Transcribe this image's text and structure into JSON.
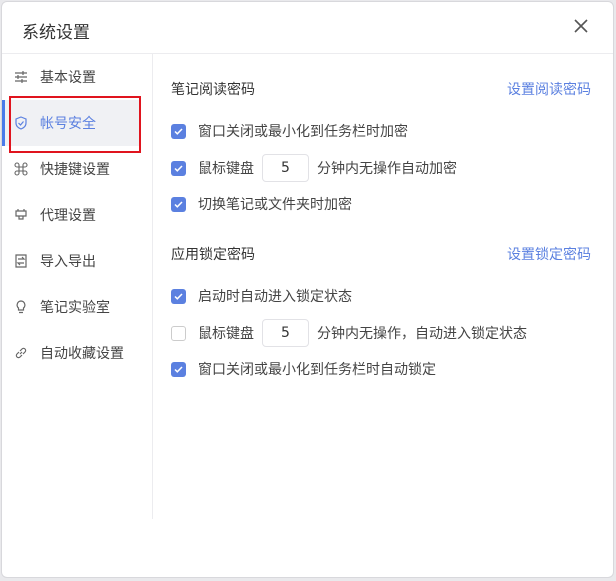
{
  "dialog": {
    "title": "系统设置",
    "close_icon": "close-icon"
  },
  "sidebar": {
    "items": [
      {
        "label": "基本设置",
        "icon": "sliders-icon"
      },
      {
        "label": "帐号安全",
        "icon": "shield-icon",
        "active": true
      },
      {
        "label": "快捷键设置",
        "icon": "command-icon"
      },
      {
        "label": "代理设置",
        "icon": "plug-icon"
      },
      {
        "label": "导入导出",
        "icon": "import-export-icon"
      },
      {
        "label": "笔记实验室",
        "icon": "bulb-icon"
      },
      {
        "label": "自动收藏设置",
        "icon": "link-icon"
      }
    ]
  },
  "read_password": {
    "heading": "笔记阅读密码",
    "link": "设置阅读密码",
    "options": [
      {
        "label": "窗口关闭或最小化到任务栏时加密",
        "checked": true
      },
      {
        "label_before": "鼠标键盘",
        "minutes": "5",
        "label_after": "分钟内无操作自动加密",
        "checked": true
      },
      {
        "label": "切换笔记或文件夹时加密",
        "checked": true
      }
    ]
  },
  "lock_password": {
    "heading": "应用锁定密码",
    "link": "设置锁定密码",
    "options": [
      {
        "label": "启动时自动进入锁定状态",
        "checked": true
      },
      {
        "label_before": "鼠标键盘",
        "minutes": "5",
        "label_after": "分钟内无操作，自动进入锁定状态",
        "checked": false
      },
      {
        "label": "窗口关闭或最小化到任务栏时自动锁定",
        "checked": true
      }
    ]
  },
  "colors": {
    "accent": "#5b80e0",
    "highlight": "#e0141e"
  }
}
